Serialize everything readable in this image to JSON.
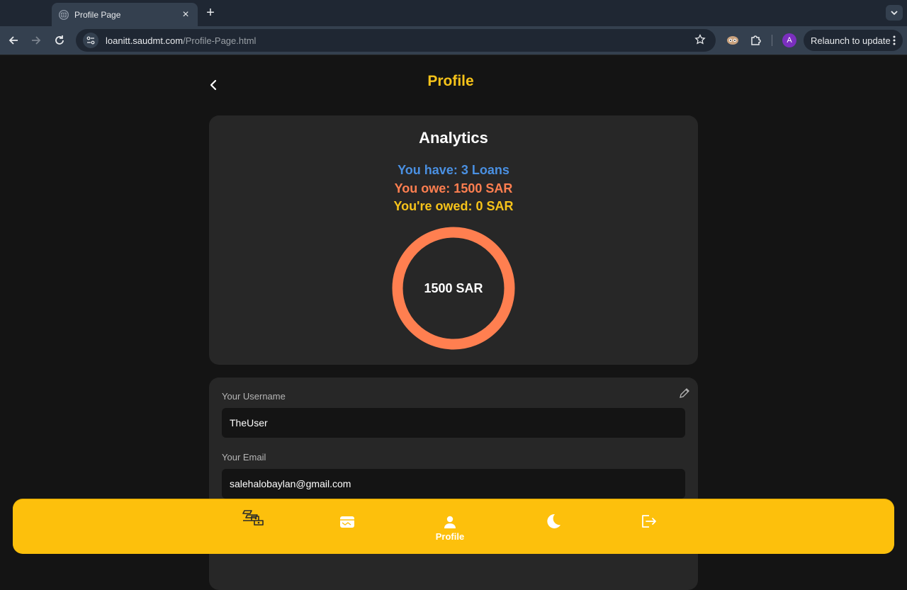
{
  "browser": {
    "tab_title": "Profile Page",
    "url_host": "loanitt.saudmt.com",
    "url_path": "/Profile-Page.html",
    "avatar_letter": "A",
    "relaunch_label": "Relaunch to update"
  },
  "header": {
    "title": "Profile"
  },
  "analytics": {
    "title": "Analytics",
    "loans_text": "You have: 3 Loans",
    "owe_text": "You owe: 1500 SAR",
    "owed_text": "You're owed: 0 SAR",
    "donut_label": "1500 SAR",
    "donut_color": "#ff7f50",
    "owe_fraction": 1.0
  },
  "profile_form": {
    "username_label": "Your Username",
    "username_value": "TheUser",
    "email_label": "Your Email",
    "email_value": "salehalobaylan@gmail.com"
  },
  "bottom_nav": {
    "items": [
      {
        "icon": "loans-icon",
        "label": ""
      },
      {
        "icon": "wallet-icon",
        "label": ""
      },
      {
        "icon": "user-icon",
        "label": "Profile"
      },
      {
        "icon": "moon-icon",
        "label": ""
      },
      {
        "icon": "logout-icon",
        "label": ""
      }
    ],
    "background": "#fdc00c"
  },
  "colors": {
    "accent": "#f6c31a",
    "loans": "#4a90e2",
    "owe": "#ff7f50",
    "owed": "#f6c31a"
  }
}
